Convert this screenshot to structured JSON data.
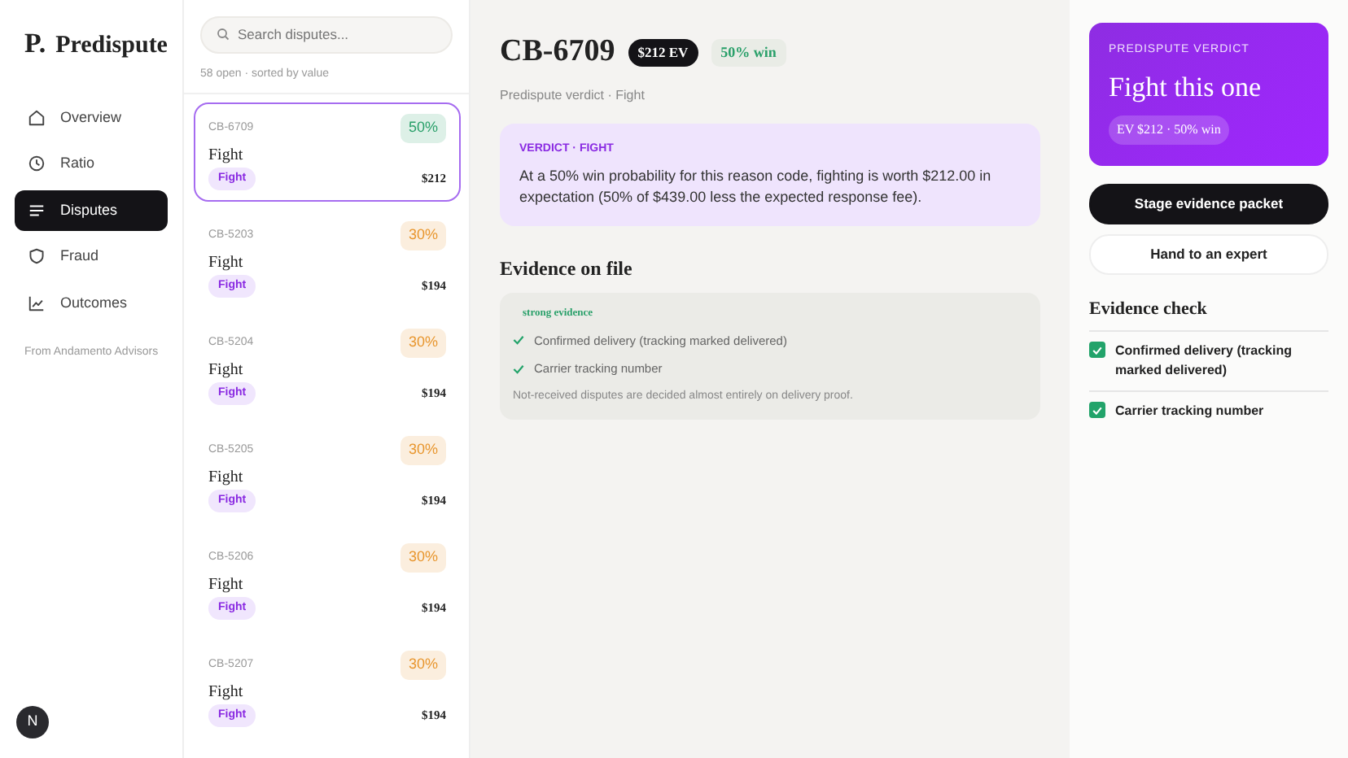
{
  "brand": {
    "mark": "P.",
    "name": "Predispute"
  },
  "nav": [
    {
      "label": "Overview",
      "selected": false
    },
    {
      "label": "Ratio",
      "selected": false
    },
    {
      "label": "Disputes",
      "selected": true
    },
    {
      "label": "Fraud",
      "selected": false
    },
    {
      "label": "Outcomes",
      "selected": false
    }
  ],
  "footer_note": "From Andamento Advisors",
  "avatar": "N",
  "search": {
    "placeholder": "Search disputes..."
  },
  "list_meta": "58 open · sorted by value",
  "disputes": [
    {
      "id": "CB-6709",
      "win": "50%",
      "color": "#2aa06a",
      "title": "Fight",
      "tag": "Fight",
      "value": "$212",
      "selected": true
    },
    {
      "id": "CB-5203",
      "win": "30%",
      "color": "#e8962e",
      "title": "Fight",
      "tag": "Fight",
      "value": "$194",
      "selected": false
    },
    {
      "id": "CB-5204",
      "win": "30%",
      "color": "#e8962e",
      "title": "Fight",
      "tag": "Fight",
      "value": "$194",
      "selected": false
    },
    {
      "id": "CB-5205",
      "win": "30%",
      "color": "#e8962e",
      "title": "Fight",
      "tag": "Fight",
      "value": "$194",
      "selected": false
    },
    {
      "id": "CB-5206",
      "win": "30%",
      "color": "#e8962e",
      "title": "Fight",
      "tag": "Fight",
      "value": "$194",
      "selected": false
    },
    {
      "id": "CB-5207",
      "win": "30%",
      "color": "#e8962e",
      "title": "Fight",
      "tag": "Fight",
      "value": "$194",
      "selected": false
    }
  ],
  "detail": {
    "id": "CB-6709",
    "ev_badge": "$212 EV",
    "win_badge": "50% win",
    "subtitle": "Predispute verdict · Fight",
    "verdict_label": "VERDICT · FIGHT",
    "verdict_text": "At a 50% win probability for this reason code, fighting is worth $212.00 in expectation (50% of $439.00 less the expected response fee).",
    "evidence_heading": "Evidence on file",
    "evidence_strength": "strong evidence",
    "evidence_items": [
      "Confirmed delivery (tracking marked delivered)",
      "Carrier tracking number"
    ],
    "evidence_note": "Not-received disputes are decided almost entirely on delivery proof."
  },
  "verdict_card": {
    "label": "PREDISPUTE VERDICT",
    "headline": "Fight this one",
    "pill": "EV $212 · 50% win"
  },
  "actions": [
    {
      "label": "Stage evidence packet",
      "kind": "primary"
    },
    {
      "label": "Hand to an expert",
      "kind": "secondary"
    }
  ],
  "evidence_check": {
    "heading": "Evidence check",
    "items": [
      {
        "label": "Confirmed delivery (tracking marked delivered)",
        "checked": true
      },
      {
        "label": "Carrier tracking number",
        "checked": true
      }
    ]
  }
}
